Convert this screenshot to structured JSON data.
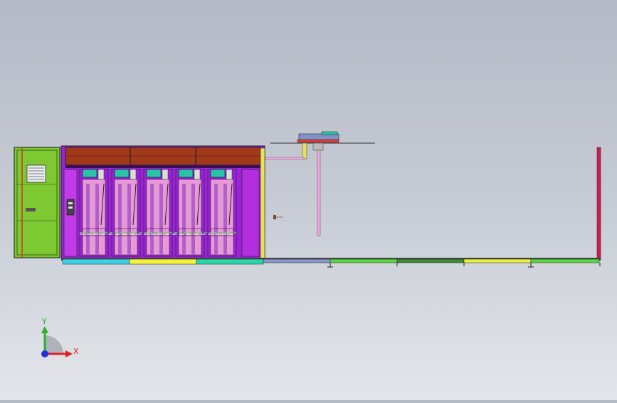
{
  "viewport": {
    "background_top": "#b4bac6",
    "background_bottom": "#e4e6ea"
  },
  "triad": {
    "x_label": "X",
    "y_label": "Y",
    "x_color": "#e0202a",
    "y_color": "#2ab12a",
    "origin_color": "#2231d8"
  },
  "model": {
    "colors": {
      "door_green": "#7ec832",
      "cabinet_purple": "#9b22d8",
      "panel_violet": "#c23bea",
      "header_brown": "#a0381a",
      "module_pink": "#e79ad8",
      "screen_teal": "#26c5a8",
      "accent_yellow": "#e8e25a",
      "rail_red": "#d21a4e",
      "pipe_pink": "#f2a6e0",
      "segment_cyan": "#3cd0e8",
      "segment_yellow": "#f2f23c",
      "segment_teal": "#28d6a8",
      "segment_slate": "#8896c8",
      "segment_green": "#56d83a",
      "segment_darkgreen": "#3a8a3a",
      "segment_lime": "#e6f03c"
    }
  }
}
